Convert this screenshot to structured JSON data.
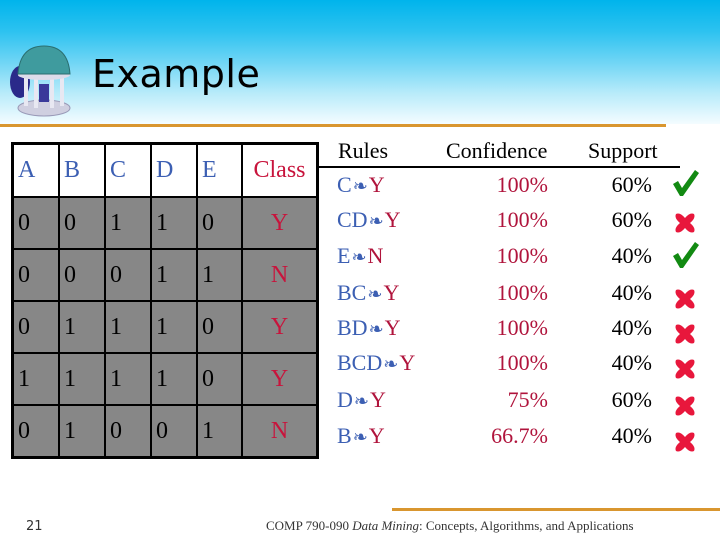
{
  "slide": {
    "title": "Example",
    "logo_icon": "old-well-icon",
    "page_number": "21",
    "footer": {
      "prefix": "COMP 790-090 ",
      "italic": "Data Mining",
      "suffix": ": Concepts, Algorithms, and Applications"
    }
  },
  "dataset": {
    "headers": [
      "A",
      "B",
      "C",
      "D",
      "E",
      "Class"
    ],
    "rows": [
      [
        "0",
        "0",
        "1",
        "1",
        "0",
        "Y"
      ],
      [
        "0",
        "0",
        "0",
        "1",
        "1",
        "N"
      ],
      [
        "0",
        "1",
        "1",
        "1",
        "0",
        "Y"
      ],
      [
        "1",
        "1",
        "1",
        "1",
        "0",
        "Y"
      ],
      [
        "0",
        "1",
        "0",
        "0",
        "1",
        "N"
      ]
    ]
  },
  "rules_table": {
    "headers": {
      "rules": "Rules",
      "confidence": "Confidence",
      "support": "Support"
    },
    "arrow_icon": "implies-arrow-icon",
    "rules": [
      {
        "lhs": "C",
        "rhs": "Y",
        "confidence": "100%",
        "support": "60%",
        "status": "check"
      },
      {
        "lhs": "CD",
        "rhs": "Y",
        "confidence": "100%",
        "support": "60%",
        "status": "cross"
      },
      {
        "lhs": "E",
        "rhs": "N",
        "confidence": "100%",
        "support": "40%",
        "status": "check"
      },
      {
        "lhs": "BC",
        "rhs": "Y",
        "confidence": "100%",
        "support": "40%",
        "status": "cross"
      },
      {
        "lhs": "BD",
        "rhs": "Y",
        "confidence": "100%",
        "support": "40%",
        "status": "cross"
      },
      {
        "lhs": "BCD",
        "rhs": "Y",
        "confidence": "100%",
        "support": "40%",
        "status": "cross"
      },
      {
        "lhs": "D",
        "rhs": "Y",
        "confidence": "75%",
        "support": "60%",
        "status": "cross"
      },
      {
        "lhs": "B",
        "rhs": "Y",
        "confidence": "66.7%",
        "support": "40%",
        "status": "cross"
      }
    ]
  },
  "colors": {
    "check": "#128a12",
    "cross": "#e8173c",
    "accent_gold": "#d9962f",
    "header_blue": "#00b4ec"
  }
}
